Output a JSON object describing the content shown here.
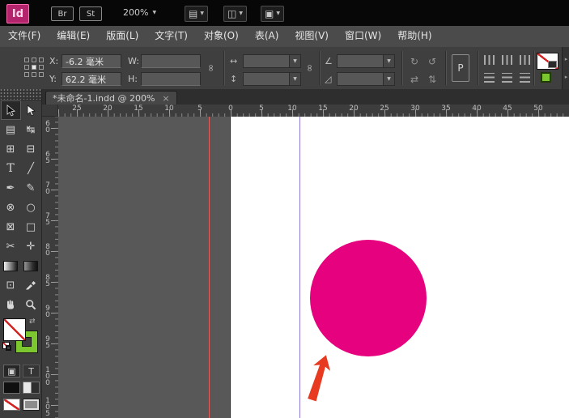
{
  "titlebar": {
    "app": "Id",
    "bridge": "Br",
    "stock": "St",
    "zoom": "200%"
  },
  "ui": {
    "dropdown_arrow": "▼",
    "view_options_icon": "▤",
    "screen_mode_icon": "◫",
    "arrange_docs_icon": "▣",
    "panel_expand_icon": "▸",
    "swap_icon": "⇄"
  },
  "menubar": {
    "items": [
      {
        "id": "file",
        "label": "文件(F)"
      },
      {
        "id": "edit",
        "label": "编辑(E)"
      },
      {
        "id": "layout",
        "label": "版面(L)"
      },
      {
        "id": "type",
        "label": "文字(T)"
      },
      {
        "id": "object",
        "label": "对象(O)"
      },
      {
        "id": "table",
        "label": "表(A)"
      },
      {
        "id": "view",
        "label": "视图(V)"
      },
      {
        "id": "window",
        "label": "窗口(W)"
      },
      {
        "id": "help",
        "label": "帮助(H)"
      }
    ]
  },
  "control_panel": {
    "x_label": "X:",
    "x_value": "-6.2 毫米",
    "y_label": "Y:",
    "y_value": "62.2 毫米",
    "w_label": "W:",
    "w_value": "",
    "h_label": "H:",
    "h_value": "",
    "link_icon": "∞",
    "scale_x_icon": "↔",
    "scale_y_icon": "↕",
    "rotation_icon": "∠",
    "shear_icon": "◿",
    "rotate_cw": "↻",
    "rotate_ccw": "↺",
    "flip_h": "⇄",
    "flip_v": "⇅",
    "p_button": "P"
  },
  "tab": {
    "title": "*未命名-1.indd @ 200%",
    "close": "×"
  },
  "rulers": {
    "horizontal_labels": [
      "25",
      "20",
      "15",
      "10",
      "5",
      "0",
      "5",
      "10",
      "15",
      "20",
      "25",
      "30",
      "35",
      "40",
      "45",
      "50"
    ],
    "vertical_labels": [
      "60",
      "65",
      "70",
      "75",
      "80",
      "85",
      "90",
      "95",
      "100",
      "105"
    ]
  },
  "tools": [
    {
      "name": "selection-tool",
      "kind": "arrow-black",
      "selected": true
    },
    {
      "name": "direct-selection-tool",
      "kind": "arrow-white"
    },
    {
      "name": "page-tool",
      "glyph": "▤"
    },
    {
      "name": "gap-tool",
      "glyph": "↹"
    },
    {
      "name": "content-collector-tool",
      "glyph": "⊞"
    },
    {
      "name": "content-placer-tool",
      "glyph": "⊟"
    },
    {
      "name": "type-tool",
      "glyph": "T"
    },
    {
      "name": "line-tool",
      "glyph": "╱"
    },
    {
      "name": "pen-tool",
      "glyph": "✒"
    },
    {
      "name": "pencil-tool",
      "glyph": "✎"
    },
    {
      "name": "ellipse-frame-tool",
      "glyph": "⊗"
    },
    {
      "name": "ellipse-tool",
      "glyph": "○"
    },
    {
      "name": "rectangle-frame-tool",
      "glyph": "⊠"
    },
    {
      "name": "rectangle-tool",
      "glyph": "□"
    },
    {
      "name": "scissors-tool",
      "glyph": "✂"
    },
    {
      "name": "free-transform-tool",
      "glyph": "✛"
    },
    {
      "name": "gradient-swatch-tool",
      "kind": "gradient"
    },
    {
      "name": "gradient-feather-tool",
      "kind": "gradient-dark"
    },
    {
      "name": "note-tool",
      "glyph": "⊡"
    },
    {
      "name": "eyedropper-tool",
      "kind": "svg-eyedropper"
    },
    {
      "name": "hand-tool",
      "kind": "svg-hand"
    },
    {
      "name": "zoom-tool",
      "kind": "svg-zoom"
    }
  ],
  "tools_bottom": {
    "container_glyph": "▣",
    "text_glyph": "T"
  },
  "colors": {
    "accent_magenta": "#e6017e",
    "stroke_green": "#7cc62f",
    "annotation_red": "#e83a21"
  },
  "canvas": {
    "pasteboard_color": "#585858",
    "page_color": "#ffffff",
    "bleed_guide_color": "#e85b5b",
    "margin_guide_color": "#8879d8",
    "circle_color": "#e6017e",
    "arrow_color": "#e83a21"
  }
}
